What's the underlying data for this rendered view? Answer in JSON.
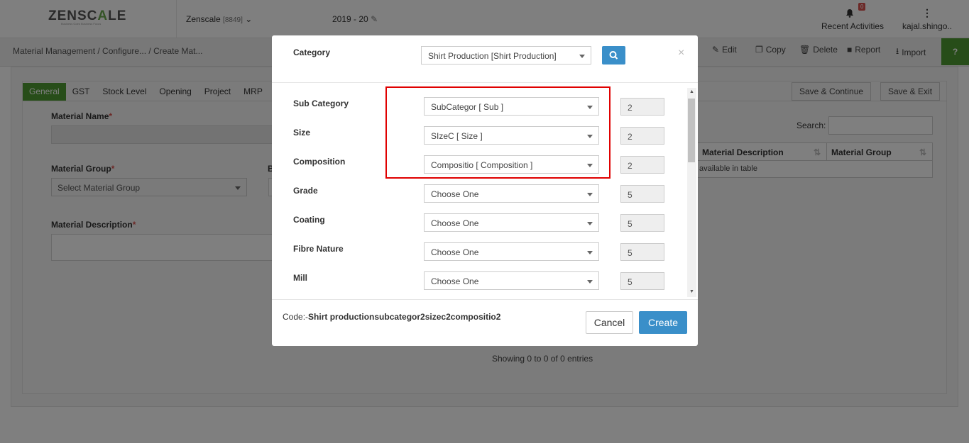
{
  "header": {
    "logo_part1": "ZENSC",
    "logo_part2": "A",
    "logo_part3": "LE",
    "logo_tagline": "Business Goes Business Focus",
    "company": "Zenscale",
    "company_id": "[8849]",
    "financial_year": "2019 - 20",
    "notification_count": "0",
    "recent_activities": "Recent Activities",
    "user": "kajal.shingo.."
  },
  "breadcrumb": "Material Management  / Configure... / Create Mat...",
  "toolbar": {
    "edit": "Edit",
    "copy": "Copy",
    "delete": "Delete",
    "report": "Report",
    "import": "Import",
    "help": "?"
  },
  "tabs": [
    "General",
    "GST",
    "Stock Level",
    "Opening",
    "Project",
    "MRP"
  ],
  "form": {
    "material_name_label": "Material Name",
    "material_group_label": "Material Group",
    "material_group_placeholder": "Select Material Group",
    "material_description_label": "Material Description",
    "partial_label": "B",
    "required_mark": "*"
  },
  "actions": {
    "save_continue": "Save & Continue",
    "save_exit": "Save & Exit"
  },
  "table": {
    "search_label": "Search:",
    "columns": [
      "Material Description",
      "Material Group"
    ],
    "empty_text": "available in table",
    "showing": "Showing 0 to 0 of 0 entries"
  },
  "modal": {
    "category_label": "Category",
    "category_value": "Shirt Production [Shirt Production]",
    "close_symbol": "×",
    "rows": [
      {
        "label": "Sub Category",
        "value": "SubCategor [ Sub ]",
        "num": "2"
      },
      {
        "label": "Size",
        "value": "SIzeC [ Size ]",
        "num": "2"
      },
      {
        "label": "Composition",
        "value": "Compositio [ Composition ]",
        "num": "2"
      },
      {
        "label": "Grade",
        "value": "Choose One",
        "num": "5"
      },
      {
        "label": "Coating",
        "value": "Choose One",
        "num": "5"
      },
      {
        "label": "Fibre Nature",
        "value": "Choose One",
        "num": "5"
      },
      {
        "label": "Mill",
        "value": "Choose One",
        "num": "5"
      }
    ],
    "code_prefix": "Code:-",
    "code_value": "Shirt productionsubcategor2sizec2compositio2",
    "cancel": "Cancel",
    "create": "Create"
  },
  "colors": {
    "accent_green": "#4e9a32",
    "primary_blue": "#3a8fc9",
    "highlight_red": "#e00000"
  }
}
